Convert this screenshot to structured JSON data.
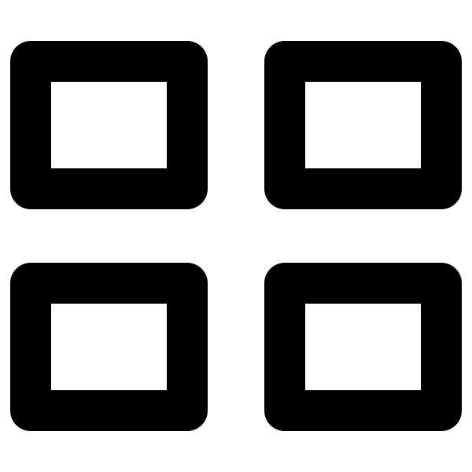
{
  "icon": {
    "name": "grid-view-icon",
    "tile_count": 4,
    "stroke_color": "#000000",
    "fill_color": "#ffffff",
    "background_color": "#ffffff"
  }
}
